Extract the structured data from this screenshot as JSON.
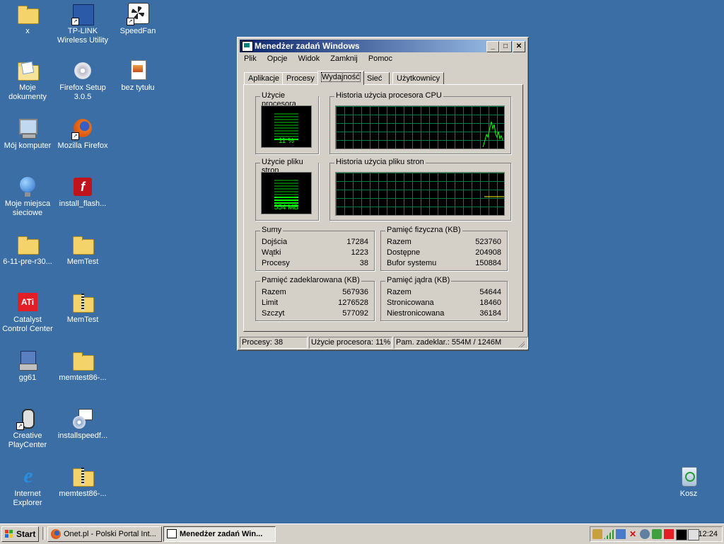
{
  "desktop": {
    "icons": [
      {
        "label": "x"
      },
      {
        "label": "TP-LINK Wireless Utility"
      },
      {
        "label": "SpeedFan"
      },
      {
        "label": "Moje dokumenty"
      },
      {
        "label": "Firefox Setup 3.0.5"
      },
      {
        "label": "bez tytułu"
      },
      {
        "label": "Mój komputer"
      },
      {
        "label": "Mozilla Firefox"
      },
      {
        "label": "Moje miejsca sieciowe"
      },
      {
        "label": "install_flash..."
      },
      {
        "label": "6-11-pre-r30..."
      },
      {
        "label": "MemTest"
      },
      {
        "label": "Catalyst Control Center"
      },
      {
        "label": "MemTest"
      },
      {
        "label": "gg61"
      },
      {
        "label": "memtest86-..."
      },
      {
        "label": "Creative PlayCenter"
      },
      {
        "label": "installspeedf..."
      },
      {
        "label": "Internet Explorer"
      },
      {
        "label": "memtest86-..."
      },
      {
        "label": "Kosz"
      }
    ]
  },
  "window": {
    "title": "Menedżer zadań Windows",
    "controls": {
      "minimize": "_",
      "maximize": "□",
      "close": "✕"
    },
    "menu": [
      "Plik",
      "Opcje",
      "Widok",
      "Zamknij",
      "Pomoc"
    ],
    "tabs": [
      "Aplikacje",
      "Procesy",
      "Wydajność",
      "Sieć",
      "Użytkownicy"
    ],
    "active_tab": "Wydajność",
    "performance": {
      "cpu_usage": {
        "title": "Użycie procesora",
        "value": "11 %",
        "level": 0.11
      },
      "cpu_history": {
        "title": "Historia użycia procesora CPU"
      },
      "pf_usage": {
        "title": "Użycie pliku stron",
        "value": "554 MB",
        "level": 0.43
      },
      "pf_history": {
        "title": "Historia użycia pliku stron"
      },
      "totals": {
        "title": "Sumy",
        "rows": [
          {
            "label": "Dojścia",
            "value": "17284"
          },
          {
            "label": "Wątki",
            "value": "1223"
          },
          {
            "label": "Procesy",
            "value": "38"
          }
        ]
      },
      "physical_memory": {
        "title": "Pamięć fizyczna (KB)",
        "rows": [
          {
            "label": "Razem",
            "value": "523760"
          },
          {
            "label": "Dostępne",
            "value": "204908"
          },
          {
            "label": "Bufor systemu",
            "value": "150884"
          }
        ]
      },
      "commit_charge": {
        "title": "Pamięć zadeklarowana (KB)",
        "rows": [
          {
            "label": "Razem",
            "value": "567936"
          },
          {
            "label": "Limit",
            "value": "1276528"
          },
          {
            "label": "Szczyt",
            "value": "577092"
          }
        ]
      },
      "kernel_memory": {
        "title": "Pamięć jądra (KB)",
        "rows": [
          {
            "label": "Razem",
            "value": "54644"
          },
          {
            "label": "Stronicowana",
            "value": "18460"
          },
          {
            "label": "Niestronicowana",
            "value": "36184"
          }
        ]
      }
    },
    "status": {
      "processes": "Procesy: 38",
      "cpu": "Użycie procesora: 11%",
      "commit": "Pam. zadeklar.: 554M / 1246M"
    }
  },
  "taskbar": {
    "start_label": "Start",
    "items": [
      {
        "label": "Onet.pl - Polski Portal Int..."
      },
      {
        "label": "Menedżer zadań Win..."
      }
    ],
    "clock": "12:24"
  },
  "colors": {
    "desktop": "#3a6ea5",
    "graph_line": "#00ff00",
    "graph_grid": "#008040",
    "title_active": "#0a246a"
  }
}
